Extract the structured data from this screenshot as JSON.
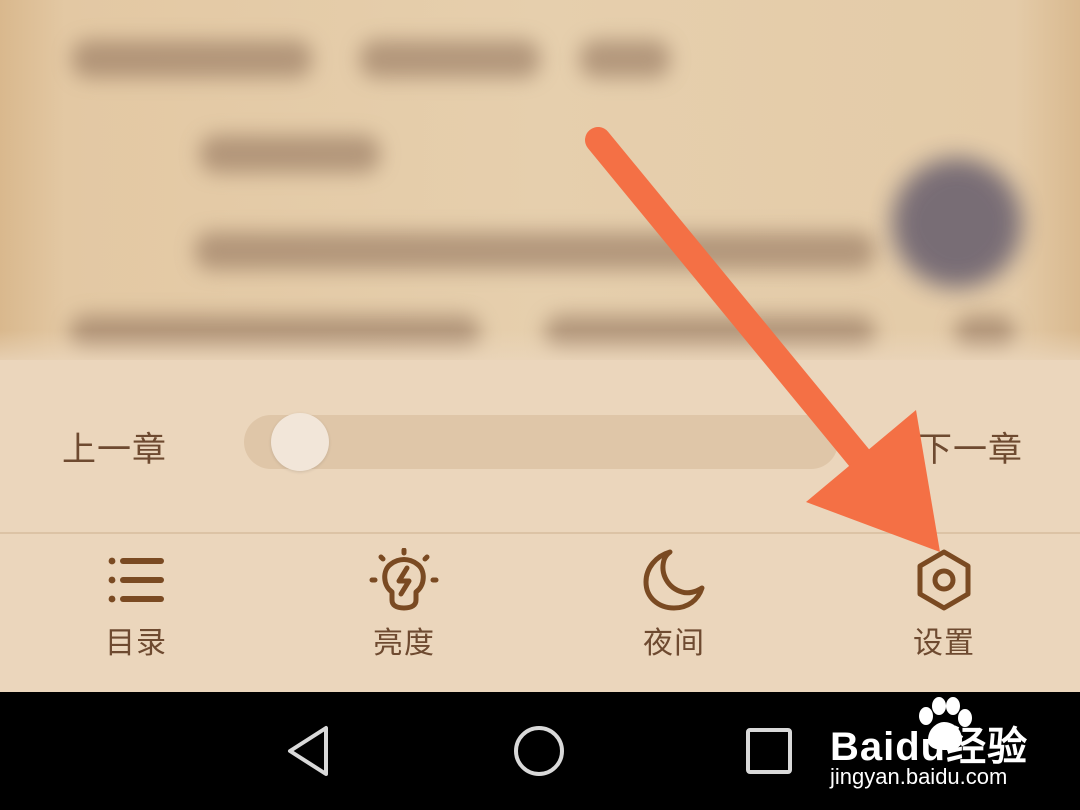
{
  "reader": {
    "content_note": ""
  },
  "chapter_nav": {
    "prev_label": "上一章",
    "next_label": "下一章",
    "progress": 0.05
  },
  "toolbar": {
    "items": [
      {
        "label": "目录",
        "icon": "list-icon"
      },
      {
        "label": "亮度",
        "icon": "lightbulb-icon"
      },
      {
        "label": "夜间",
        "icon": "moon-icon"
      },
      {
        "label": "设置",
        "icon": "hexagon-settings-icon"
      }
    ]
  },
  "system_nav": {
    "buttons": [
      "back-triangle-icon",
      "home-circle-icon",
      "recents-square-icon"
    ]
  },
  "watermark": {
    "brand": "Baidu经验",
    "url": "jingyan.baidu.com"
  },
  "colors": {
    "panel_bg": "#ebd6bc",
    "text_brown": "#6e4a30",
    "icon_brown": "#7a4a22",
    "arrow": "#f47045",
    "nav_bg": "#000000"
  }
}
